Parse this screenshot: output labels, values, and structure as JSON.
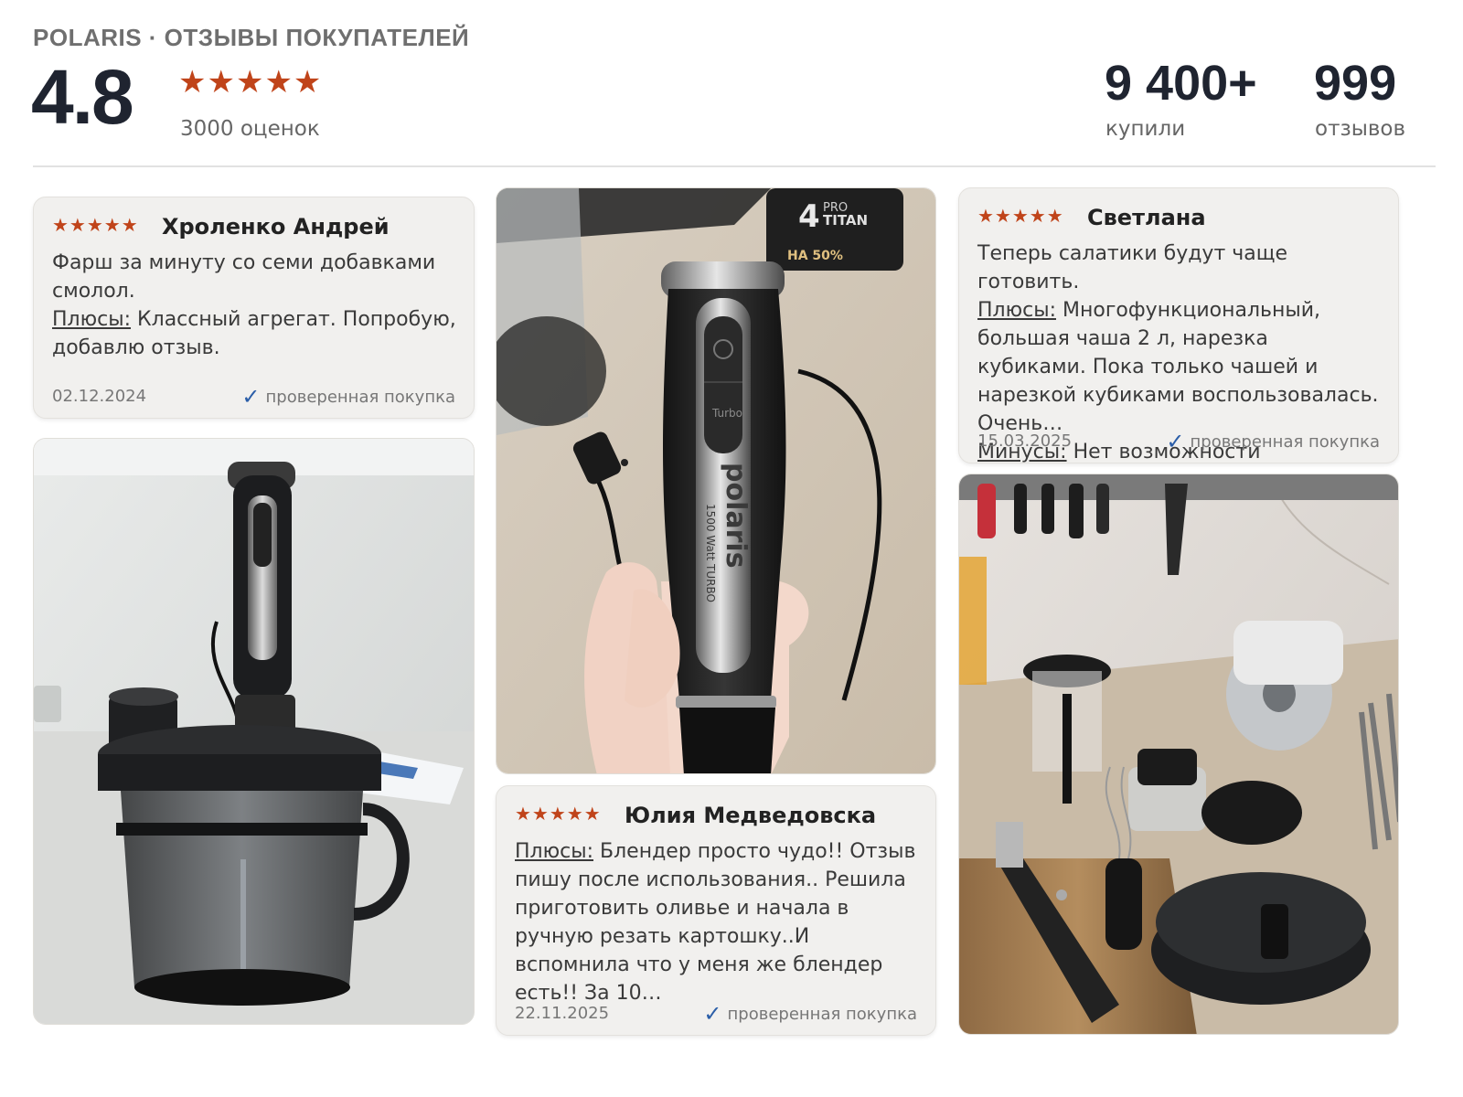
{
  "header": {
    "brand": "POLARIS · ОТЗЫВЫ ПОКУПАТЕЛЕЙ",
    "rating": "4.8",
    "stars": "★★★★★",
    "ratings_count": "3000 оценок",
    "bought_value": "9 400+",
    "bought_label": "купили",
    "reviews_value": "999",
    "reviews_label": "отзывов"
  },
  "colors": {
    "star": "#c0441a",
    "check": "#2b5ea8",
    "card_bg": "#f1f0ee"
  },
  "reviews": [
    {
      "stars": "★★★★★",
      "author": "Хроленко Андрей",
      "text": "Фарш за минуту со семи добавками смолол.",
      "pros_label": "Плюсы:",
      "pros": "Классный агрегат. Попробую, добавлю отзыв.",
      "date": "02.12.2024",
      "verified": "проверенная покупка"
    },
    {
      "stars": "★★★★★",
      "author": "Светлана",
      "text": "Теперь салатики будут чаще готовить.",
      "pros_label": "Плюсы:",
      "pros": "Многофункциональный, большая чаша 2 л, нарезка кубиками. Пока только чашей и нарезкой кубиками воспользовалась. Очень…",
      "cons_label": "Минусы:",
      "cons": "Нет возможности докупить…",
      "date": "15.03.2025",
      "verified": "проверенная покупка"
    },
    {
      "stars": "★★★★★",
      "author": "Юлия Медведовска",
      "pros_label": "Плюсы:",
      "pros": "Блендер просто чудо!! Отзыв пишу после использования.. Решила приготовить оливье и начала в ручную резать картошку..И вспомнила что у меня же блендер есть!! За 10…",
      "date": "22.11.2025",
      "verified": "проверенная покупка"
    }
  ],
  "photos": {
    "blender_hand": {
      "brand_text": "polaris",
      "model_text": "1500 Watt TURBO",
      "turbo_text": "Turbo",
      "box_text_1": "PRO",
      "box_text_2": "TITAN",
      "box_text_3": "НА 50%"
    }
  }
}
